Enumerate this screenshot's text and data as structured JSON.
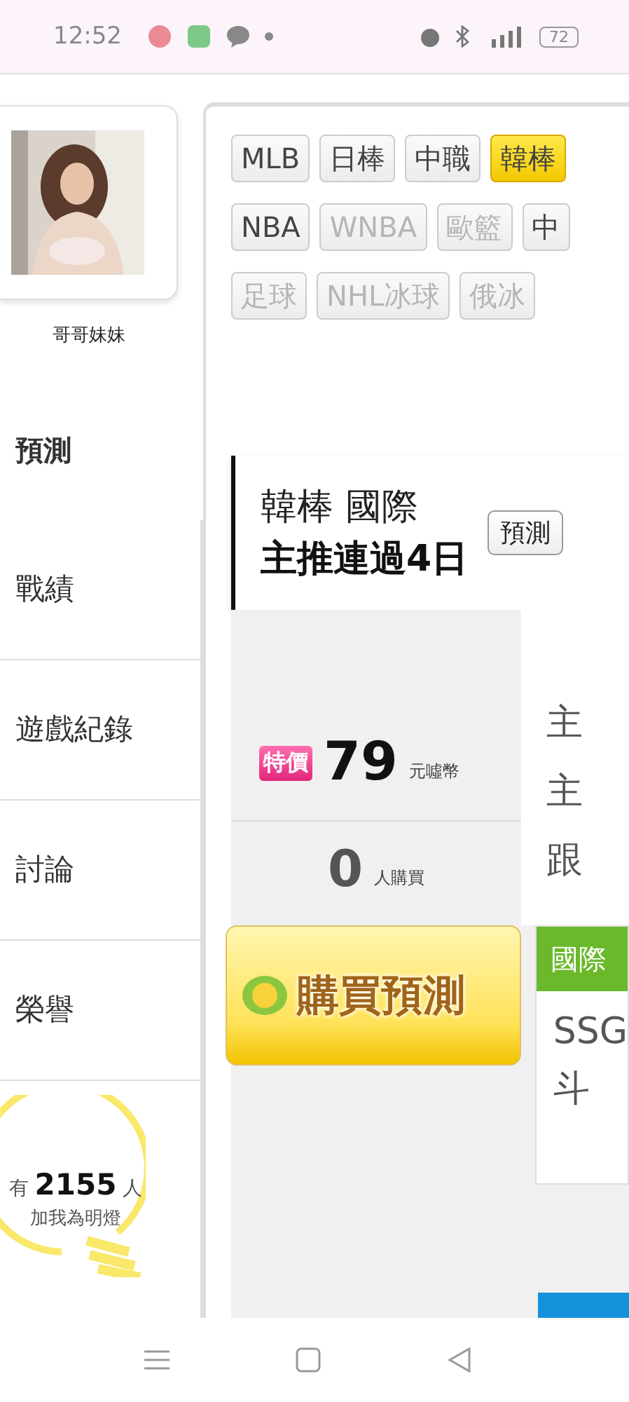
{
  "status_bar": {
    "time": "12:52",
    "battery": "72"
  },
  "profile": {
    "name": "哥哥妹妹"
  },
  "side_menu": [
    {
      "label": "預測",
      "selected": true
    },
    {
      "label": "戰績",
      "selected": false
    },
    {
      "label": "遊戲紀錄",
      "selected": false
    },
    {
      "label": "討論",
      "selected": false
    },
    {
      "label": "榮譽",
      "selected": false
    }
  ],
  "fans": {
    "count_text": "有 **2155** 人",
    "caption": "加我為明燈"
  },
  "league_tabs": [
    [
      {
        "label": "MLB",
        "selected": false,
        "disabled": false
      },
      {
        "label": "日棒",
        "selected": false,
        "disabled": false
      },
      {
        "label": "中職",
        "selected": false,
        "disabled": false
      },
      {
        "label": "韓棒",
        "selected": true,
        "disabled": false
      }
    ],
    [
      {
        "label": "NBA",
        "selected": false,
        "disabled": false
      },
      {
        "label": "WNBA",
        "selected": false,
        "disabled": true
      },
      {
        "label": "歐籃",
        "selected": false,
        "disabled": true
      },
      {
        "label": "中",
        "selected": false,
        "disabled": false
      }
    ],
    [
      {
        "label": "足球",
        "selected": false,
        "disabled": true
      },
      {
        "label": "NHL冰球",
        "selected": false,
        "disabled": true
      },
      {
        "label": "俄冰",
        "selected": false,
        "disabled": true
      }
    ]
  ],
  "prediction": {
    "league": "韓棒 國際",
    "streak": "主推連過4日",
    "record_button": "預測",
    "badge": "特價",
    "price": "79",
    "currency": "元噓幣",
    "buyers": "0",
    "buyers_unit": "人購買",
    "lines": [
      "主",
      "主",
      "跟"
    ],
    "buy_button": "購買預測",
    "game": {
      "category": "國際",
      "lines": [
        "SSG",
        "斗"
      ]
    }
  }
}
